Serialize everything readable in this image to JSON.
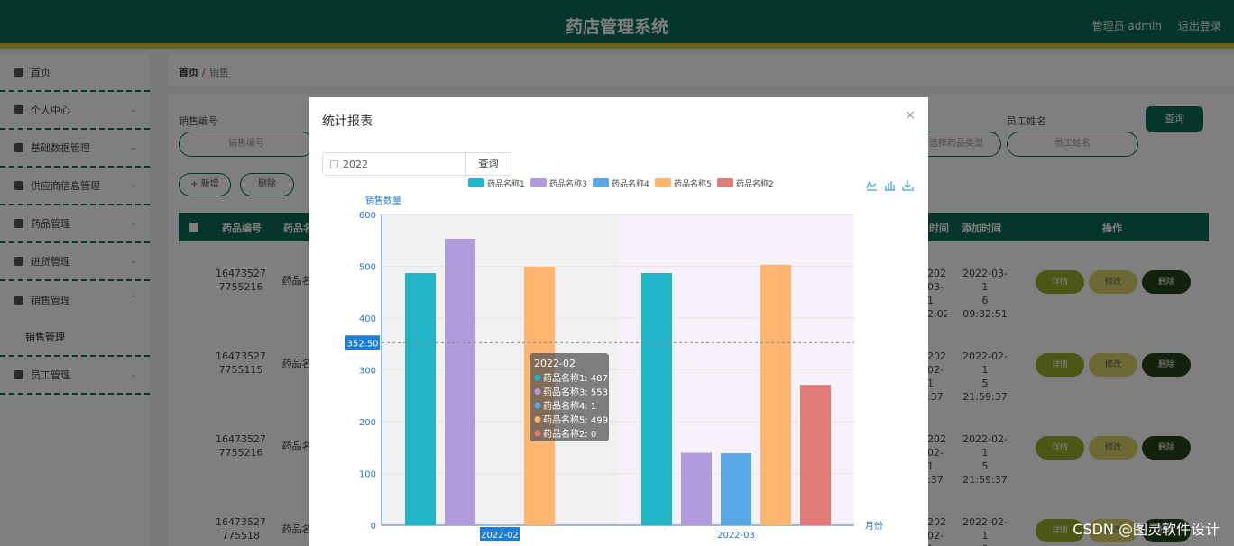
{
  "header": {
    "title": "药店管理系统",
    "user": "管理员 admin",
    "logout": "退出登录"
  },
  "sidebar": {
    "items": [
      {
        "label": "首页",
        "icon": "home-icon"
      },
      {
        "label": "个人中心",
        "icon": "user-icon"
      },
      {
        "label": "基础数据管理",
        "icon": "bulb-icon"
      },
      {
        "label": "供应商信息管理",
        "icon": "server-icon"
      },
      {
        "label": "药品管理",
        "icon": "settings-icon"
      },
      {
        "label": "进货管理",
        "icon": "card-icon"
      },
      {
        "label": "销售管理",
        "icon": "clipboard-icon"
      },
      {
        "label": "员工管理",
        "icon": "id-icon"
      }
    ],
    "sub": "销售管理"
  },
  "breadcrumb": {
    "home": "首页",
    "sep": "/",
    "current": "销售"
  },
  "search": {
    "sales_no_label": "销售编号",
    "sales_no_placeholder": "销售编号",
    "employee_label": "员工姓名",
    "employee_placeholder": "员工姓名",
    "select_placeholder": "请选择药品类型",
    "query": "查询"
  },
  "toolbar": {
    "add": "+ 新增",
    "delete": "删除"
  },
  "table": {
    "headers": [
      "药品编号",
      "药品名",
      "时间",
      "添加时间",
      "操作"
    ],
    "rows": [
      {
        "code": "16473527\n7755216",
        "name": "药品名",
        "time": "2022-03-1\n2:02",
        "added": "2022-03-1\n6 09:32:51"
      },
      {
        "code": "16473527\n7755115",
        "name": "药品名",
        "time": "2022-02-1\n:37",
        "added": "2022-02-1\n5 21:59:37"
      },
      {
        "code": "16473527\n7755216",
        "name": "药品名",
        "time": "2022-02-1\n:37",
        "added": "2022-02-1\n5 21:59:37"
      },
      {
        "code": "16473527\n775518",
        "name": "药品名",
        "time": "2022-02-1\n:37",
        "added": "2022-02-1\n5 21:59:37"
      }
    ],
    "actions": {
      "detail": "详情",
      "edit": "修改",
      "delete": "删除"
    }
  },
  "modal": {
    "title": "统计报表",
    "close": "×",
    "year_value": "2022",
    "query": "查询",
    "toolbox": [
      "line-chart-icon",
      "bar-chart-icon",
      "download-icon"
    ]
  },
  "chart_data": {
    "type": "bar",
    "categories": [
      "2022-02",
      "2022-03"
    ],
    "ylabel": "销售数量",
    "xlabel": "月份",
    "ylim": [
      0,
      600
    ],
    "yticks": [
      0,
      100,
      200,
      300,
      400,
      500,
      600
    ],
    "grid": true,
    "legend_position": "top",
    "series": [
      {
        "name": "药品名称1",
        "values": [
          487,
          487
        ],
        "color": "#22b5c7"
      },
      {
        "name": "药品名称3",
        "values": [
          553,
          140
        ],
        "color": "#b09cdc"
      },
      {
        "name": "药品名称4",
        "values": [
          1,
          139
        ],
        "color": "#58a8e8"
      },
      {
        "name": "药品名称5",
        "values": [
          499,
          503
        ],
        "color": "#ffb570"
      },
      {
        "name": "药品名称2",
        "values": [
          0,
          271
        ],
        "color": "#e07b78"
      }
    ],
    "crosshair_value": "352.50",
    "active_category": "2022-02",
    "tooltip": {
      "title": "2022-02",
      "lines": [
        "药品名称1: 487",
        "药品名称3: 553",
        "药品名称4: 1",
        "药品名称5: 499",
        "药品名称2: 0"
      ]
    }
  },
  "watermark": "CSDN @图灵软件设计"
}
